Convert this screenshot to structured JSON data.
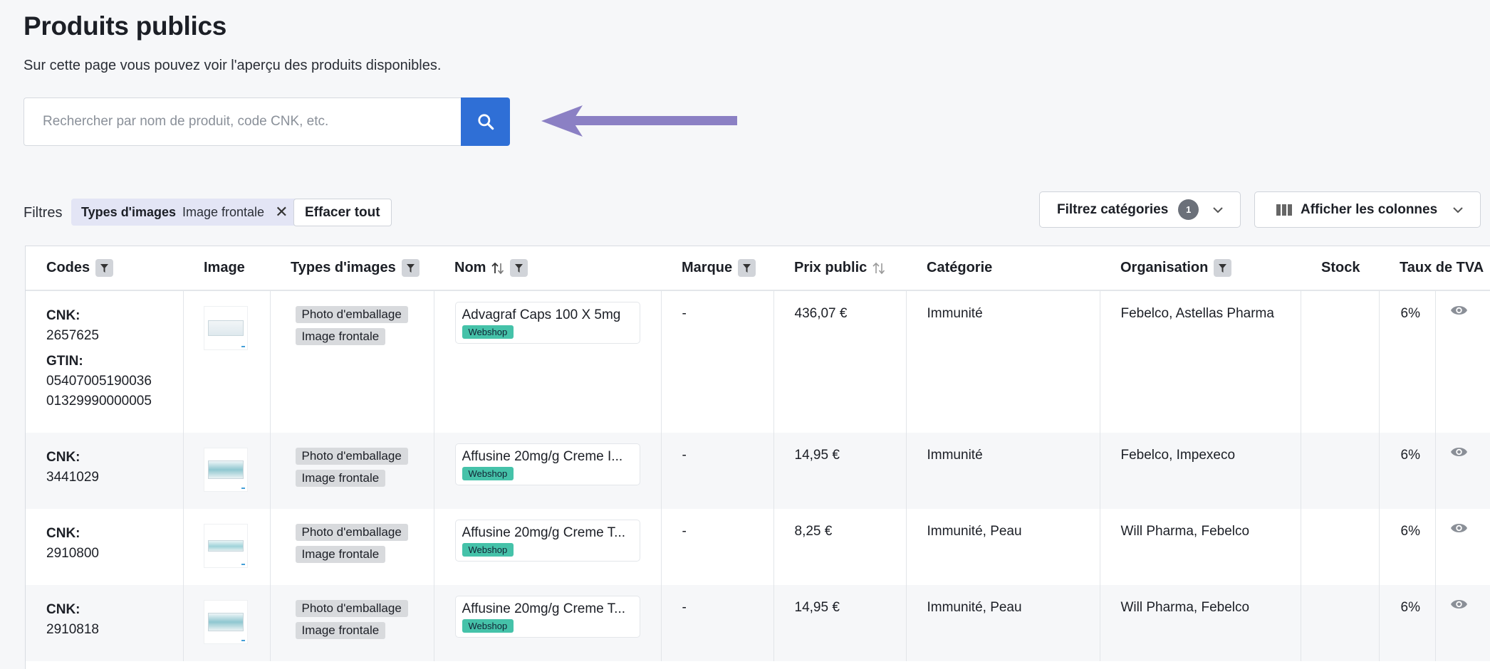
{
  "page": {
    "title": "Produits publics",
    "subtitle": "Sur cette page vous pouvez voir l'aperçu des produits disponibles."
  },
  "search": {
    "placeholder": "Rechercher par nom de produit, code CNK, etc."
  },
  "filters": {
    "label": "Filtres",
    "chip": {
      "key": "Types d'images",
      "value": "Image frontale",
      "remove": "✕"
    },
    "clear_all": "Effacer tout"
  },
  "toolbar": {
    "categories_label": "Filtrez catégories",
    "categories_count": "1",
    "columns_label": "Afficher les colonnes"
  },
  "table": {
    "headers": {
      "codes": "Codes",
      "image": "Image",
      "types": "Types d'images",
      "nom": "Nom",
      "marque": "Marque",
      "prix": "Prix public",
      "categorie": "Catégorie",
      "organisation": "Organisation",
      "stock": "Stock",
      "tva": "Taux de TVA"
    },
    "cnk_label": "CNK:",
    "gtin_label": "GTIN:",
    "webshop_label": "Webshop",
    "rows": [
      {
        "cnk": "2657625",
        "gtin": [
          "05407005190036",
          "01329990000005"
        ],
        "types": [
          "Photo d'emballage",
          "Image frontale"
        ],
        "nom": "Advagraf Caps 100 X 5mg",
        "marque": "-",
        "prix": "436,07 €",
        "categorie": "Immunité",
        "organisation": "Febelco, Astellas Pharma",
        "stock": "",
        "tva": "6%"
      },
      {
        "cnk": "3441029",
        "types": [
          "Photo d'emballage",
          "Image frontale"
        ],
        "nom": "Affusine 20mg/g Creme I...",
        "marque": "-",
        "prix": "14,95 €",
        "categorie": "Immunité",
        "organisation": "Febelco, Impexeco",
        "stock": "",
        "tva": "6%"
      },
      {
        "cnk": "2910800",
        "types": [
          "Photo d'emballage",
          "Image frontale"
        ],
        "nom": "Affusine 20mg/g Creme T...",
        "marque": "-",
        "prix": "8,25 €",
        "categorie": "Immunité, Peau",
        "organisation": "Will Pharma, Febelco",
        "stock": "",
        "tva": "6%"
      },
      {
        "cnk": "2910818",
        "types": [
          "Photo d'emballage",
          "Image frontale"
        ],
        "nom": "Affusine 20mg/g Creme T...",
        "marque": "-",
        "prix": "14,95 €",
        "categorie": "Immunité, Peau",
        "organisation": "Will Pharma, Febelco",
        "stock": "",
        "tva": "6%"
      }
    ]
  },
  "colors": {
    "primary": "#2f6fd6",
    "arrow": "#8b80c4",
    "chip_bg": "#e3e5f5",
    "webshop": "#45c2a9"
  }
}
